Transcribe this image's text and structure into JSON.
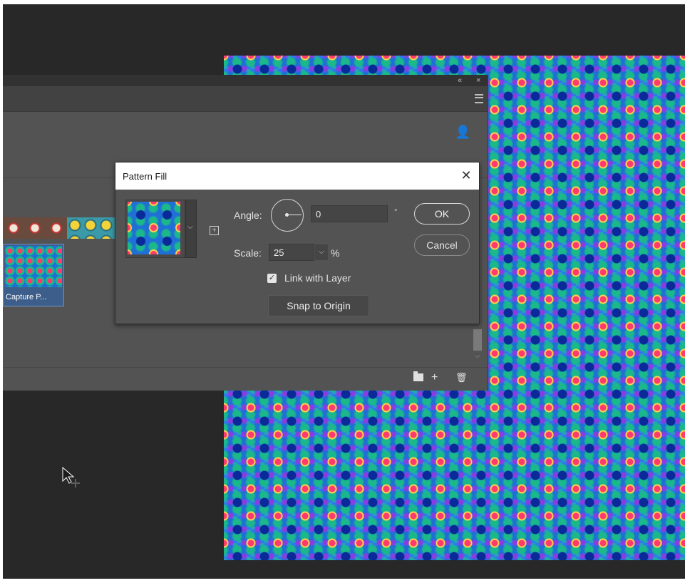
{
  "patterns_panel": {
    "collapse_glyph": "«",
    "close_glyph": "×",
    "selected_pattern_caption": "Capture P...",
    "scroll_down_glyph": "⌵",
    "footer": {
      "new_pattern_glyph": "+",
      "delete_glyph": "🗑"
    },
    "library_icon_glyph": "👤"
  },
  "pattern_fill_dialog": {
    "title": "Pattern Fill",
    "close_glyph": "✕",
    "angle_label": "Angle:",
    "angle_value": "0",
    "degree_symbol": "°",
    "scale_label": "Scale:",
    "scale_value": "25",
    "scale_dropdown_glyph": "⌵",
    "percent_symbol": "%",
    "link_with_layer_label": "Link with Layer",
    "link_with_layer_checked": true,
    "checkmark_glyph": "✓",
    "snap_to_origin_label": "Snap to Origin",
    "ok_label": "OK",
    "cancel_label": "Cancel",
    "preview_dropdown_glyph": "⌵",
    "new_preset_glyph": "+"
  },
  "colors": {
    "workspace_bg": "#282828",
    "panel_bg": "#535353",
    "dialog_title_bg": "#ffffff",
    "pattern_blue": "#1f6fd6",
    "pattern_pink": "#ff3b6e",
    "pattern_teal": "#1bb98a"
  }
}
